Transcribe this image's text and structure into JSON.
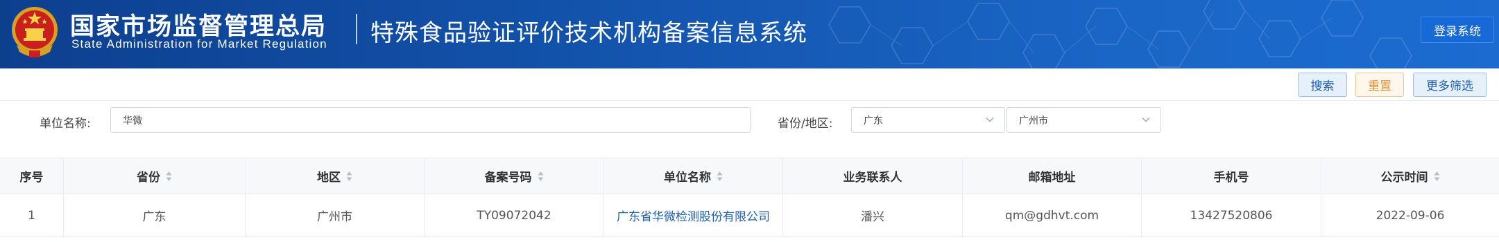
{
  "header": {
    "org_name_cn": "国家市场监督管理总局",
    "org_name_en": "State Administration  for  Market Regulation",
    "system_title": "特殊食品验证评价技术机构备案信息系统",
    "login_label": "登录系统",
    "colors": {
      "header_start": "#0d3f8f",
      "header_end": "#1b6bd0",
      "login_bg": "#1769d8"
    }
  },
  "actions": {
    "search_label": "搜索",
    "reset_label": "重置",
    "more_filter_label": "更多筛选"
  },
  "filters": {
    "unit_label": "单位名称:",
    "unit_value": "华微",
    "region_label": "省份/地区:",
    "province_value": "广东",
    "city_value": "广州市"
  },
  "table": {
    "columns": [
      "序号",
      "省份",
      "地区",
      "备案号码",
      "单位名称",
      "业务联系人",
      "邮箱地址",
      "手机号",
      "公示时间"
    ],
    "rows": [
      [
        "1",
        "广东",
        "广州市",
        "TY09072042",
        "广东省华微检测股份有限公司",
        "潘兴",
        "qm@gdhvt.com",
        "13427520806",
        "2022-09-06"
      ]
    ]
  },
  "icons": {
    "emblem": "national-emblem-icon",
    "sort": "sort-icon",
    "dropdown": "chevron-down-icon"
  }
}
